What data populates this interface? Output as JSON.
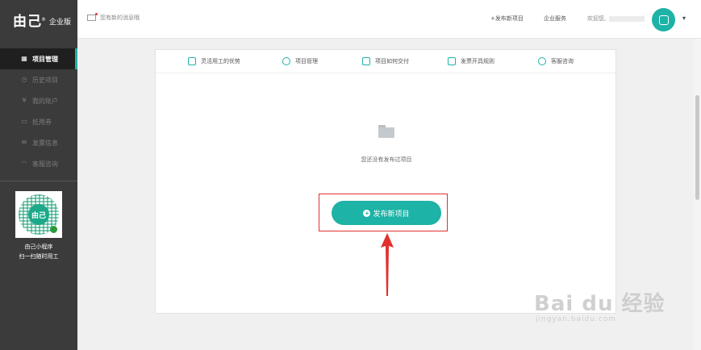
{
  "brand": {
    "logo": "由己",
    "logo_sup": "®",
    "edition": "企业版"
  },
  "sidebar": {
    "items": [
      {
        "label": "项目管理",
        "icon": "grid-icon",
        "active": true
      },
      {
        "label": "历史项目",
        "icon": "clock-icon",
        "active": false
      },
      {
        "label": "我的账户",
        "icon": "yen-icon",
        "active": false
      },
      {
        "label": "抵用券",
        "icon": "coupon-icon",
        "active": false
      },
      {
        "label": "发票信息",
        "icon": "invoice-icon",
        "active": false
      },
      {
        "label": "客服咨询",
        "icon": "headset-icon",
        "active": false
      }
    ],
    "qr_caption_1": "由己小程序",
    "qr_caption_2": "扫一扫随时用工",
    "qr_center": "由己"
  },
  "header": {
    "messages": "您有新的消息哦",
    "publish_link": "+发布新项目",
    "enterprise_service": "企业服务",
    "welcome": "欢迎您,",
    "caret": "▾"
  },
  "tabs": [
    {
      "label": "灵活用工的优势",
      "icon": "advantage-icon"
    },
    {
      "label": "项目管理",
      "icon": "project-icon"
    },
    {
      "label": "项目如何交付",
      "icon": "deliver-icon"
    },
    {
      "label": "发票开具规则",
      "icon": "invoice-rule-icon"
    },
    {
      "label": "客服咨询",
      "icon": "support-icon"
    }
  ],
  "main": {
    "empty_text": "您还没有发布过项目",
    "publish_button": "发布新项目",
    "plus": "+"
  },
  "watermark": {
    "main": "Bai du 经验",
    "sub": "jingyan.baidu.com"
  },
  "colors": {
    "accent": "#1db3a6",
    "highlight": "#e0312f",
    "sidebar": "#3b3b3b"
  }
}
